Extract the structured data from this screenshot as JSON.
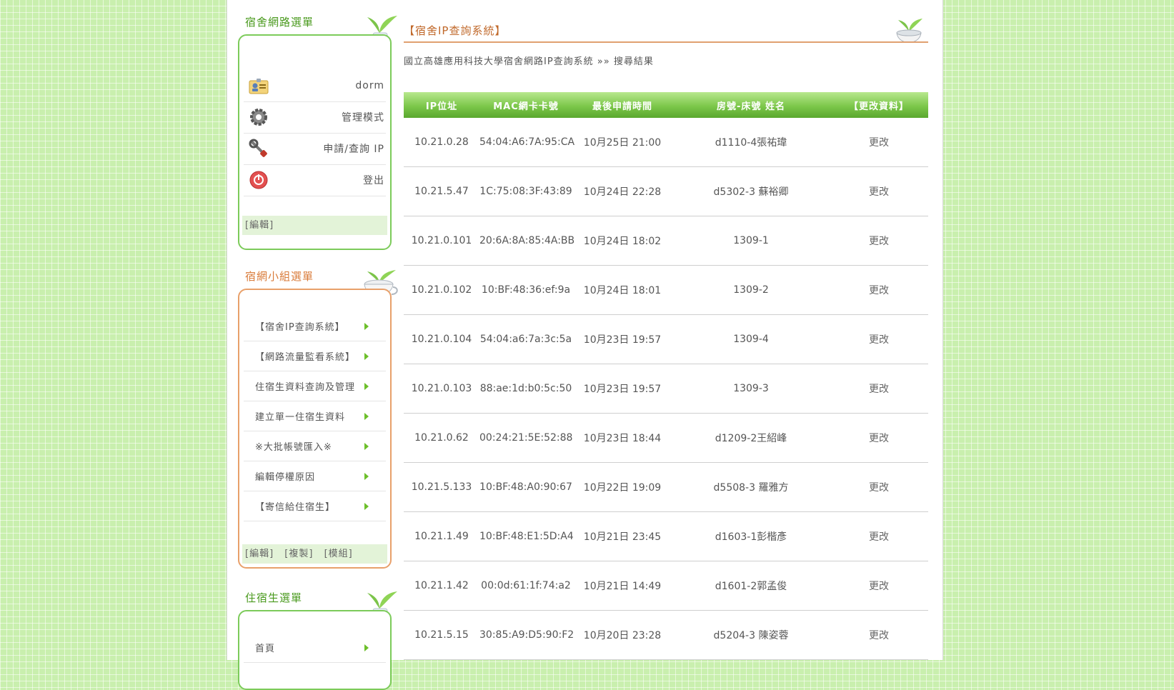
{
  "sidebar": {
    "dorm_menu": {
      "title": "宿舍網路選單",
      "user": "dorm",
      "items": [
        "管理模式",
        "申請/查詢 IP",
        "登出"
      ],
      "edit": "[編輯]"
    },
    "team_menu": {
      "title": "宿網小組選單",
      "items": [
        "【宿舍IP查詢系統】",
        "【網路流量監看系統】",
        "住宿生資料查詢及管理",
        "建立單一住宿生資料",
        "※大批帳號匯入※",
        "編輯停權原因",
        "【寄信給住宿生】"
      ],
      "actions": [
        "[編輯]",
        "[複製]",
        "[模組]"
      ]
    },
    "resident_menu": {
      "title": "住宿生選單",
      "items": [
        "首頁"
      ]
    }
  },
  "main": {
    "title": "【宿舍IP查詢系統】",
    "breadcrumb": "國立高雄應用科技大學宿舍網路IP查詢系統 »» 搜尋結果",
    "table": {
      "headers": [
        "IP位址",
        "MAC網卡卡號",
        "最後申請時間",
        "房號-床號 姓名",
        "【更改資料】"
      ],
      "rows": [
        {
          "ip": "10.21.0.28",
          "mac": "54:04:A6:7A:95:CA",
          "time": "10月25日 21:00",
          "room": "d1110-4張祐瑋",
          "action": "更改"
        },
        {
          "ip": "10.21.5.47",
          "mac": "1C:75:08:3F:43:89",
          "time": "10月24日 22:28",
          "room": "d5302-3 蘇裕卿",
          "action": "更改"
        },
        {
          "ip": "10.21.0.101",
          "mac": "20:6A:8A:85:4A:BB",
          "time": "10月24日 18:02",
          "room": "1309-1",
          "action": "更改"
        },
        {
          "ip": "10.21.0.102",
          "mac": "10:BF:48:36:ef:9a",
          "time": "10月24日 18:01",
          "room": "1309-2",
          "action": "更改"
        },
        {
          "ip": "10.21.0.104",
          "mac": "54:04:a6:7a:3c:5a",
          "time": "10月23日 19:57",
          "room": "1309-4",
          "action": "更改"
        },
        {
          "ip": "10.21.0.103",
          "mac": "88:ae:1d:b0:5c:50",
          "time": "10月23日 19:57",
          "room": "1309-3",
          "action": "更改"
        },
        {
          "ip": "10.21.0.62",
          "mac": "00:24:21:5E:52:88",
          "time": "10月23日 18:44",
          "room": "d1209-2王紹峰",
          "action": "更改"
        },
        {
          "ip": "10.21.5.133",
          "mac": "10:BF:48:A0:90:67",
          "time": "10月22日 19:09",
          "room": "d5508-3 羅雅方",
          "action": "更改"
        },
        {
          "ip": "10.21.1.49",
          "mac": "10:BF:48:E1:5D:A4",
          "time": "10月21日 23:45",
          "room": "d1603-1彭楷彥",
          "action": "更改"
        },
        {
          "ip": "10.21.1.42",
          "mac": "00:0d:61:1f:74:a2",
          "time": "10月21日 14:49",
          "room": "d1601-2郭孟俊",
          "action": "更改"
        },
        {
          "ip": "10.21.5.15",
          "mac": "30:85:A9:D5:90:F2",
          "time": "10月20日 23:28",
          "room": "d5204-3 陳姿蓉",
          "action": "更改"
        }
      ]
    }
  },
  "colors": {
    "background": "#c9efae",
    "green_accent": "#7ccb5a",
    "orange_accent": "#e8a06a",
    "header_green": "#6cbf3a"
  }
}
